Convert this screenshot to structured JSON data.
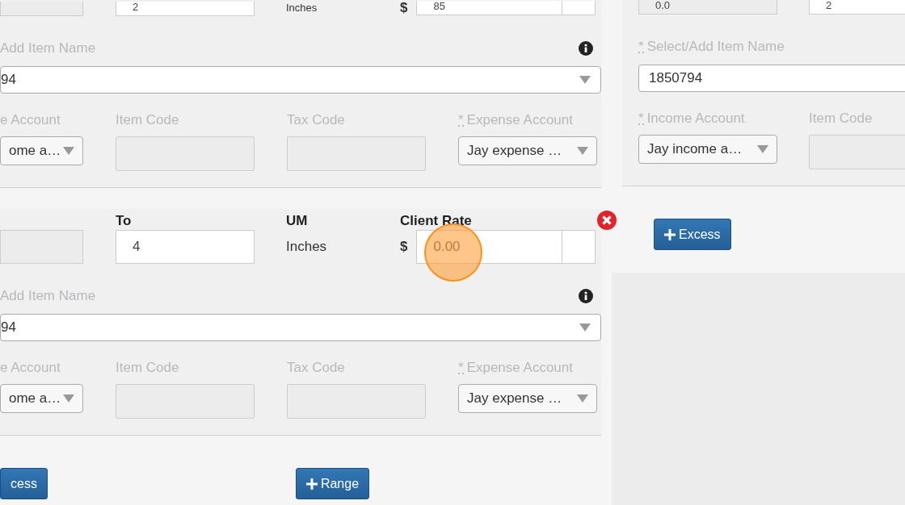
{
  "left_panel": {
    "entries": [
      {
        "kind": "clipped",
        "removable": false,
        "to_value": "2",
        "um": "Inches",
        "currency": "$",
        "rate_value": "85",
        "highlighted": false,
        "item_label": {
          "text": "Add Item Name"
        },
        "item_value": "94",
        "info": true,
        "accounts": [
          {
            "kind": "select",
            "label": "e Account",
            "value": "ome a…"
          },
          {
            "kind": "text",
            "label": "Item Code"
          },
          {
            "kind": "text",
            "label": "Tax Code"
          },
          {
            "kind": "select",
            "label": "Expense Account",
            "required_mark": "*",
            "value": "Jay expense …"
          }
        ]
      },
      {
        "kind": "full",
        "header": {
          "to": "To",
          "um": "UM",
          "rate": "Client Rate"
        },
        "removable": true,
        "to_value": "4",
        "um": "Inches",
        "currency": "$",
        "rate_placeholder": "0.00",
        "highlighted": true,
        "item_label": {
          "text": "Add Item Name"
        },
        "item_value": "94",
        "info": true,
        "accounts": [
          {
            "kind": "select",
            "label": "e Account",
            "value": "ome a…"
          },
          {
            "kind": "text",
            "label": "Item Code"
          },
          {
            "kind": "text",
            "label": "Tax Code"
          },
          {
            "kind": "select",
            "label": "Expense Account",
            "required_mark": "*",
            "value": "Jay expense …"
          }
        ]
      }
    ],
    "buttons": [
      {
        "kind": "plain",
        "label": "cess"
      },
      {
        "kind": "plus",
        "label": "Range"
      }
    ]
  },
  "right_panel": {
    "entry": {
      "from_value": "0.0",
      "to_value": "2",
      "item_label": {
        "required_mark": "*",
        "text": "Select/Add Item Name"
      },
      "item_value": "1850794",
      "accounts": [
        {
          "kind": "select",
          "label": "Income Account",
          "required_mark": "*",
          "value": "Jay income a…"
        },
        {
          "kind": "text",
          "label": "Item Code"
        }
      ]
    },
    "buttons": [
      {
        "kind": "plus",
        "label": "Excess"
      }
    ]
  }
}
